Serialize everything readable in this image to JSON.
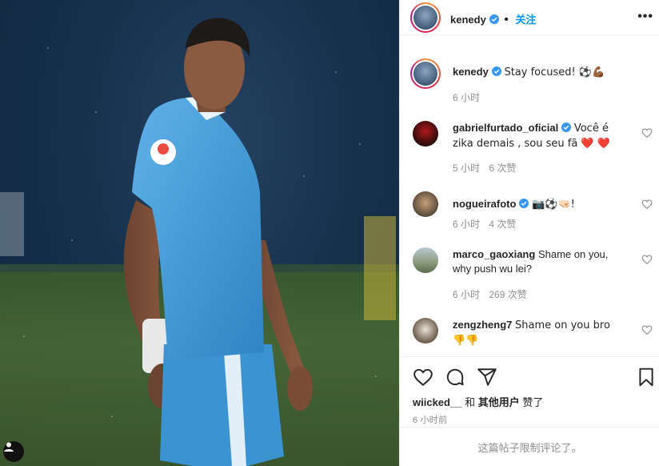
{
  "post": {
    "author": "kenedy",
    "follow_label": "关注",
    "more_label": "•••",
    "caption": {
      "username": "kenedy",
      "text": "Stay focused! ⚽💪🏾",
      "time": "6 小时"
    }
  },
  "comments": [
    {
      "username": "gabrielfurtado_oficial",
      "verified": true,
      "text": "Você é zika demais , sou seu fã ❤️ ❤️",
      "time": "5 小时",
      "likes": "6 次赞"
    },
    {
      "username": "nogueirafoto",
      "verified": true,
      "text": "📷⚽🤜🏻!",
      "time": "6 小时",
      "likes": "4 次赞"
    },
    {
      "username": "marco_gaoxiang",
      "verified": false,
      "text": "Shame on you, why push wu lei?",
      "time": "6 小时",
      "likes": "269 次赞"
    },
    {
      "username": "zengzheng7",
      "verified": false,
      "text": "Shame on you bro 👎👎",
      "time": "",
      "likes": ""
    }
  ],
  "liked_by": {
    "user": "wiicked__",
    "connector": "和",
    "others": "其他用户",
    "suffix": "赞了"
  },
  "timestamp": "6 小时前",
  "comments_disabled": "这篇帖子限制评论了。",
  "icons": [
    "heart-icon",
    "comment-icon",
    "share-icon",
    "bookmark-icon",
    "verified-icon",
    "more-icon",
    "profile-icon"
  ],
  "colors": {
    "accent": "#0095f6",
    "verified": "#3897f0",
    "jersey": "#4a9fd8"
  }
}
